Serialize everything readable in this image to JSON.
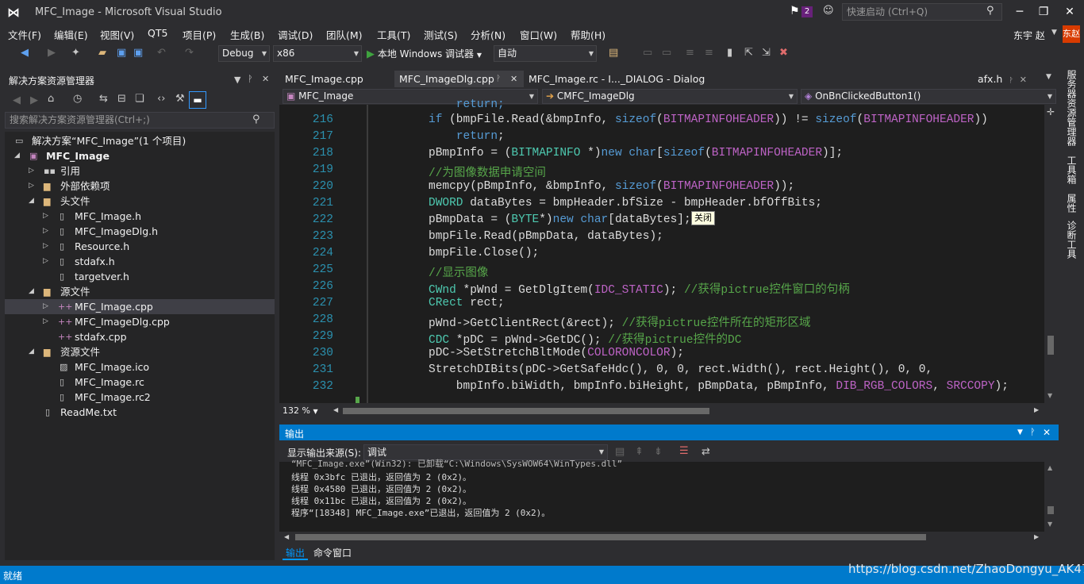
{
  "titlebar": {
    "logo": "⋈",
    "title": "MFC_Image - Microsoft Visual Studio",
    "notif_count": "2",
    "quick_launch": "快速启动 (Ctrl+Q)",
    "minimize": "─",
    "restore": "❐",
    "close": "✕"
  },
  "menu": [
    "文件(F)",
    "编辑(E)",
    "视图(V)",
    "QT5",
    "项目(P)",
    "生成(B)",
    "调试(D)",
    "团队(M)",
    "工具(T)",
    "测试(S)",
    "分析(N)",
    "窗口(W)",
    "帮助(H)"
  ],
  "user": {
    "name": "东宇 赵",
    "avatar": "东赵"
  },
  "toolbar": {
    "config": "Debug",
    "platform": "x86",
    "run_label": "本地 Windows 调试器",
    "run_mode": "自动"
  },
  "solution_explorer": {
    "title": "解决方案资源管理器",
    "search_placeholder": "搜索解决方案资源管理器(Ctrl+;)",
    "items": [
      {
        "label": "解决方案“MFC_Image”(1 个项目)"
      },
      {
        "label": "MFC_Image"
      },
      {
        "label": "引用"
      },
      {
        "label": "外部依赖项"
      },
      {
        "label": "头文件"
      },
      {
        "label": "MFC_Image.h"
      },
      {
        "label": "MFC_ImageDlg.h"
      },
      {
        "label": "Resource.h"
      },
      {
        "label": "stdafx.h"
      },
      {
        "label": "targetver.h"
      },
      {
        "label": "源文件"
      },
      {
        "label": "MFC_Image.cpp"
      },
      {
        "label": "MFC_ImageDlg.cpp"
      },
      {
        "label": "stdafx.cpp"
      },
      {
        "label": "资源文件"
      },
      {
        "label": "MFC_Image.ico"
      },
      {
        "label": "MFC_Image.rc"
      },
      {
        "label": "MFC_Image.rc2"
      },
      {
        "label": "ReadMe.txt"
      }
    ]
  },
  "editor": {
    "tabs": [
      "MFC_Image.cpp",
      "MFC_ImageDlg.cpp",
      "MFC_Image.rc - I..._DIALOG - Dialog",
      "afx.h"
    ],
    "nav": {
      "project": "MFC_Image",
      "class": "CMFC_ImageDlg",
      "member": "OnBnClickedButton1()"
    },
    "line_numbers": [
      "216",
      "217",
      "218",
      "219",
      "220",
      "221",
      "222",
      "223",
      "224",
      "225",
      "226",
      "227",
      "228",
      "229",
      "230",
      "231",
      "232"
    ],
    "tooltip": "关闭",
    "zoom": "132 %"
  },
  "output": {
    "title": "输出",
    "source_label": "显示输出来源(S):",
    "source_value": "调试",
    "lines": [
      "“MFC_Image.exe”(Win32): 已卸载“C:\\Windows\\SysWOW64\\WinTypes.dll”",
      "线程 0x3bfc 已退出，返回值为 2 (0x2)。",
      "线程 0x4580 已退出，返回值为 2 (0x2)。",
      "线程 0x11bc 已退出，返回值为 2 (0x2)。",
      "程序“[18348] MFC_Image.exe”已退出，返回值为 2 (0x2)。"
    ],
    "tabs": [
      "输出",
      "命令窗口"
    ]
  },
  "right_tabs": [
    "服务器资源管理器",
    "工具箱",
    "属性",
    "诊断工具"
  ],
  "status": {
    "text": "就绪"
  },
  "watermark": "https://blog.csdn.net/ZhaoDongyu_AK47",
  "colors": {
    "accent": "#007acc",
    "keyword": "#569cd6",
    "type": "#4ec9b0",
    "comment": "#57a64a",
    "macro": "#bd63c5",
    "line_number": "#2b91af"
  }
}
